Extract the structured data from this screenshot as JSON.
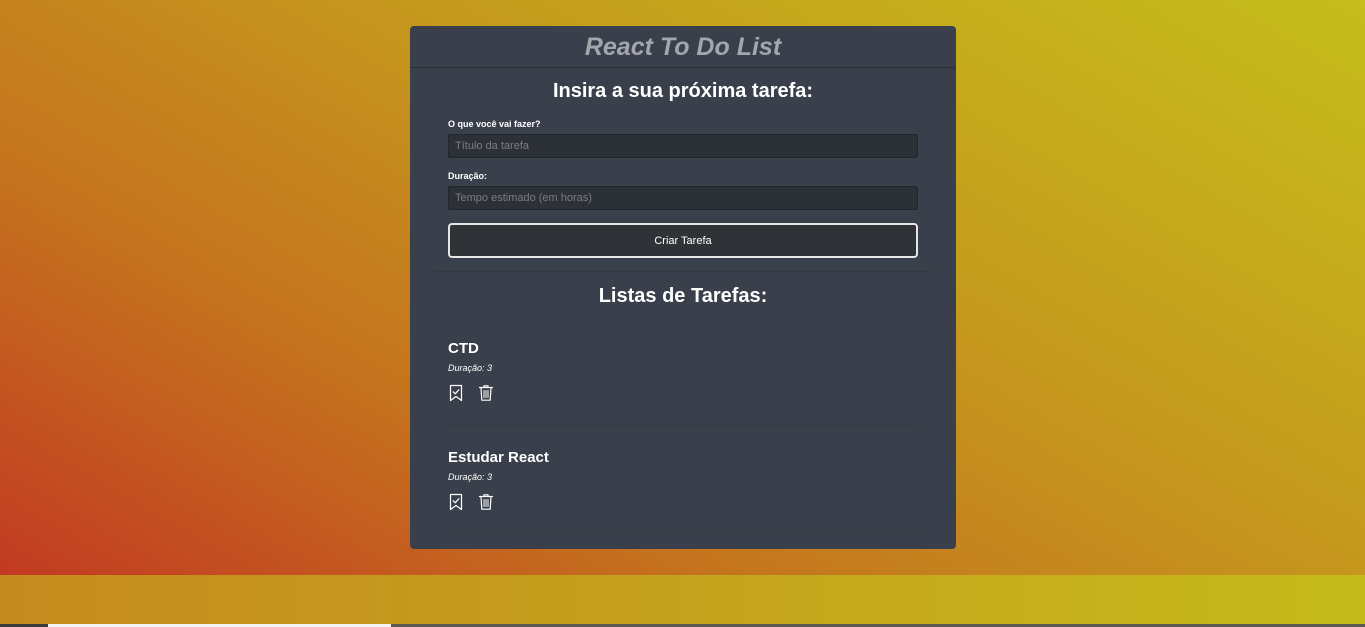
{
  "app": {
    "title": "React To Do List"
  },
  "form": {
    "heading": "Insira a sua próxima tarefa:",
    "title_label": "O que você vai fazer?",
    "title_placeholder": "Título da tarefa",
    "title_value": "",
    "duration_label": "Duração:",
    "duration_placeholder": "Tempo estimado (em horas)",
    "duration_value": "",
    "submit_label": "Criar Tarefa"
  },
  "list": {
    "heading": "Listas de Tarefas:",
    "tasks": [
      {
        "title": "CTD",
        "duration": "Duração: 3",
        "icons": [
          "bookmark-check-icon",
          "trash-icon"
        ]
      },
      {
        "title": "Estudar React",
        "duration": "Duração: 3",
        "icons": [
          "bookmark-check-icon",
          "trash-icon"
        ]
      }
    ]
  },
  "colors": {
    "panel": "#3a404b",
    "input_bg": "#2c3037",
    "button_bg": "#2f3236",
    "title_gray": "#a3a6ab",
    "bg_red": "#c23a22",
    "bg_orange": "#c5731e",
    "bg_yellow": "#c5be1b"
  }
}
